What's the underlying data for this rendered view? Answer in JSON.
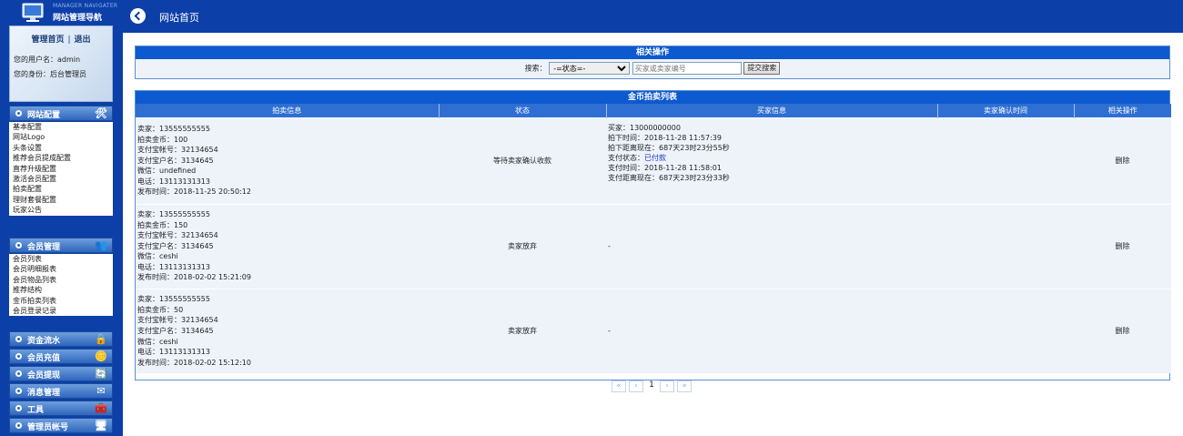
{
  "sidebar": {
    "logo_small": "MANAGER NAVIGATER",
    "logo_title": "网站管理导航",
    "links": {
      "home": "管理首页",
      "sep": "|",
      "logout": "退出"
    },
    "username_line": "您的用户名：admin",
    "role_line": "您的身份：后台管理员",
    "sections": [
      {
        "label": "网站配置",
        "icon": "tools-icon",
        "items": [
          "基本配置",
          "网站Logo",
          "头条设置",
          "推荐会员提成配置",
          "直荐升级配置",
          "激活会员配置",
          "拍卖配置",
          "理财套餐配置",
          "玩家公告"
        ]
      },
      {
        "label": "会员管理",
        "icon": "users-icon",
        "items": [
          "会员列表",
          "会员明细报表",
          "会员物品列表",
          "推荐结构",
          "金币拍卖列表",
          "会员登录记录"
        ]
      },
      {
        "label": "资金流水",
        "icon": "lock-icon",
        "items": []
      },
      {
        "label": "会员充值",
        "icon": "coins-icon",
        "items": []
      },
      {
        "label": "会员提现",
        "icon": "exchange-icon",
        "items": []
      },
      {
        "label": "消息管理",
        "icon": "message-icon",
        "items": []
      },
      {
        "label": "工具",
        "icon": "toolbox-icon",
        "items": []
      },
      {
        "label": "管理员帐号",
        "icon": "admin-icon",
        "items": []
      }
    ]
  },
  "header": {
    "title": "网站首页"
  },
  "ops": {
    "title": "相关操作",
    "search_label": "搜索：",
    "status_selected": "-=状态=-",
    "search_placeholder": "买家或卖家编号",
    "submit_label": "提交搜索"
  },
  "list": {
    "title": "金币拍卖列表",
    "columns": [
      "拍卖信息",
      "状态",
      "买家信息",
      "卖家确认时间",
      "相关操作"
    ],
    "rows": [
      {
        "info": [
          "卖家：13555555555",
          "拍卖金币：100",
          "支付宝帐号：32134654",
          "支付宝户名：3134645",
          "微信：undefined",
          "电话：13113131313",
          "发布时间：2018-11-25 20:50:12"
        ],
        "status": "等待卖家确认收款",
        "buyer": [
          "买家：13000000000",
          "拍下时间：2018-11-28 11:57:39",
          "拍下距离现在：687天23时23分55秒"
        ],
        "pay_status_label": "支付状态：",
        "pay_status_value": "已付款",
        "buyer_after": [
          "支付时间：2018-11-28 11:58:01",
          "支付距离现在：687天23时23分33秒"
        ],
        "confirm_time": "",
        "action": "删除"
      },
      {
        "info": [
          "卖家：13555555555",
          "拍卖金币：150",
          "支付宝帐号：32134654",
          "支付宝户名：3134645",
          "微信：ceshi",
          "电话：13113131313",
          "发布时间：2018-02-02 15:21:09"
        ],
        "status": "卖家放弃",
        "buyer_text": "-",
        "confirm_time": "",
        "action": "删除"
      },
      {
        "info": [
          "卖家：13555555555",
          "拍卖金币：50",
          "支付宝帐号：32134654",
          "支付宝户名：3134645",
          "微信：ceshi",
          "电话：13113131313",
          "发布时间：2018-02-02 15:12:10"
        ],
        "status": "卖家放弃",
        "buyer_text": "-",
        "confirm_time": "",
        "action": "删除"
      }
    ]
  },
  "pager": {
    "first": "«",
    "prev": "‹",
    "current": "1",
    "next": "›",
    "last": "»"
  }
}
